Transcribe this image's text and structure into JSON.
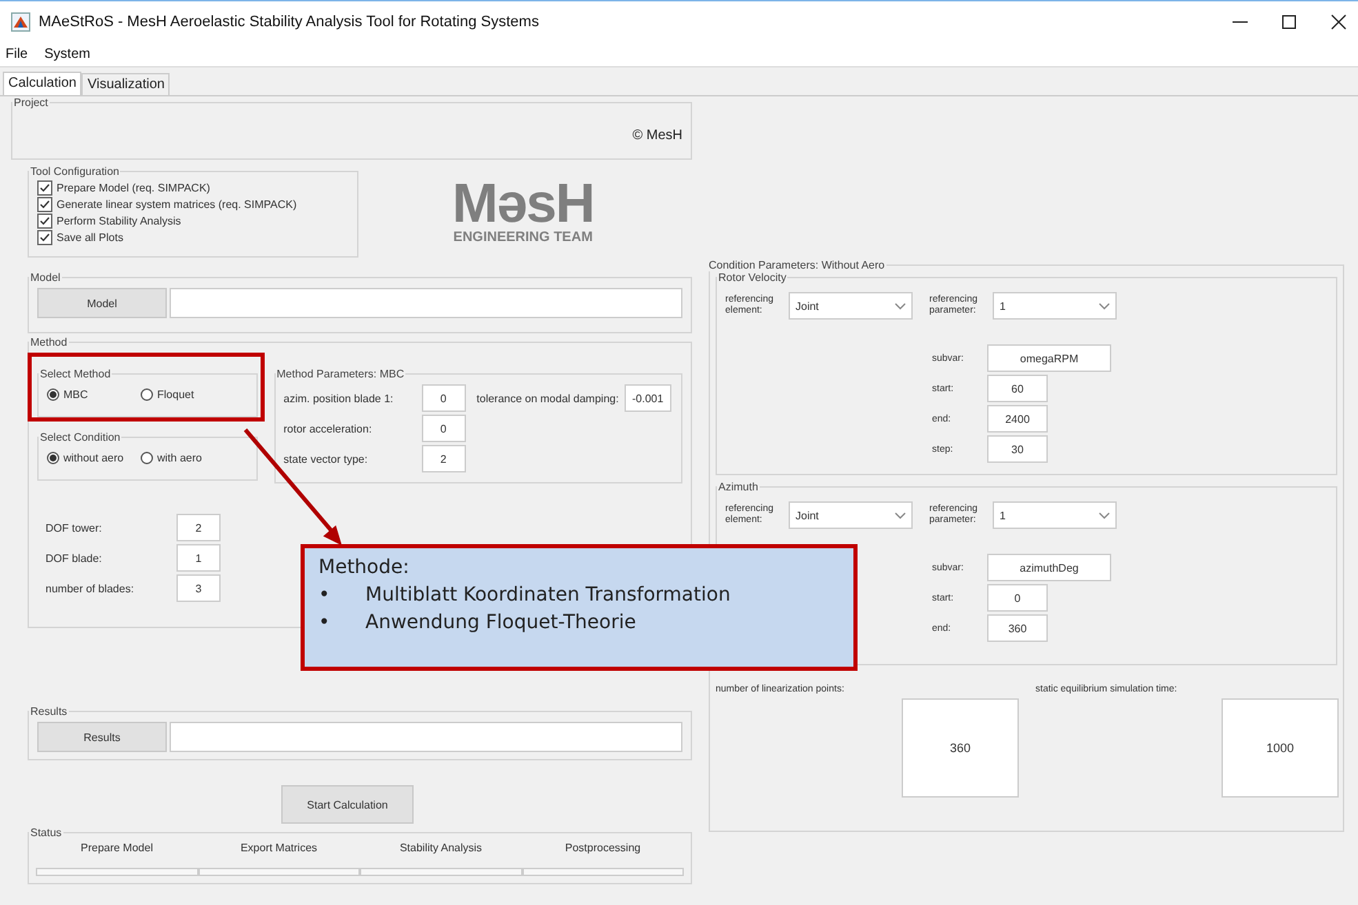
{
  "window": {
    "title": "MAeStRoS - MesH Aeroelastic Stability Analysis Tool for Rotating Systems"
  },
  "menu": [
    "File",
    "System"
  ],
  "tabs": [
    {
      "label": "Calculation",
      "selected": true
    },
    {
      "label": "Visualization",
      "selected": false
    }
  ],
  "project": {
    "title": "Project",
    "copyright": "© MesH"
  },
  "tool_configuration": {
    "title": "Tool Configuration",
    "options": [
      {
        "label": "Prepare Model (req. SIMPACK)",
        "checked": true
      },
      {
        "label": "Generate linear system matrices (req. SIMPACK)",
        "checked": true
      },
      {
        "label": "Perform Stability Analysis",
        "checked": true
      },
      {
        "label": "Save all Plots",
        "checked": true
      }
    ]
  },
  "logo": {
    "name": "MəsH",
    "tagline": "ENGINEERING TEAM"
  },
  "model": {
    "title": "Model",
    "button": "Model"
  },
  "method": {
    "title": "Method",
    "select_method": {
      "title": "Select Method",
      "options": [
        {
          "label": "MBC",
          "selected": true
        },
        {
          "label": "Floquet",
          "selected": false
        }
      ]
    },
    "select_condition": {
      "title": "Select Condition",
      "options": [
        {
          "label": "without aero",
          "selected": true
        },
        {
          "label": "with aero",
          "selected": false
        }
      ]
    },
    "parameters": {
      "title": "Method Parameters: MBC",
      "fields": [
        {
          "label": "azim. position blade 1:",
          "value": "0"
        },
        {
          "label": "rotor acceleration:",
          "value": "0"
        },
        {
          "label": "state vector type:",
          "value": "2"
        }
      ],
      "tolerance": {
        "label": "tolerance on modal damping:",
        "value": "-0.001"
      }
    },
    "dof_fields": [
      {
        "label": "DOF tower:",
        "value": "2"
      },
      {
        "label": "DOF blade:",
        "value": "1"
      },
      {
        "label": "number of blades:",
        "value": "3"
      }
    ]
  },
  "callout": {
    "title": "Methode:",
    "bullet": "•",
    "items": [
      "Multiblatt Koordinaten Transformation",
      "Anwendung Floquet-Theorie"
    ]
  },
  "results": {
    "title": "Results",
    "button": "Results"
  },
  "start_button": "Start Calculation",
  "status": {
    "title": "Status",
    "steps": [
      {
        "label": "Prepare Model",
        "level": 0
      },
      {
        "label": "Export Matrices",
        "level": 0
      },
      {
        "label": "Stability Analysis",
        "level": 0
      },
      {
        "label": "Postprocessing",
        "level": 0
      }
    ]
  },
  "condition": {
    "title": "Condition Parameters: Without Aero",
    "groups": [
      {
        "title": "Rotor Velocity",
        "element_label": "referencing element:",
        "element_value": "Joint",
        "parameter_label": "referencing parameter:",
        "parameter_value": "1",
        "fields": [
          {
            "label": "subvar:",
            "value": "omegaRPM"
          },
          {
            "label": "start:",
            "value": "60"
          },
          {
            "label": "end:",
            "value": "2400"
          },
          {
            "label": "step:",
            "value": "30"
          }
        ]
      },
      {
        "title": "Azimuth",
        "element_label": "referencing element:",
        "element_value": "Joint",
        "parameter_label": "referencing parameter:",
        "parameter_value": "1",
        "fields": [
          {
            "label": "subvar:",
            "value": "azimuthDeg"
          },
          {
            "label": "start:",
            "value": "0"
          },
          {
            "label": "end:",
            "value": "360"
          }
        ]
      }
    ],
    "linearization": {
      "label": "number of linearization points:",
      "value": "360"
    },
    "equilibrium": {
      "label": "static equilibrium simulation time:",
      "value": "1000"
    }
  }
}
